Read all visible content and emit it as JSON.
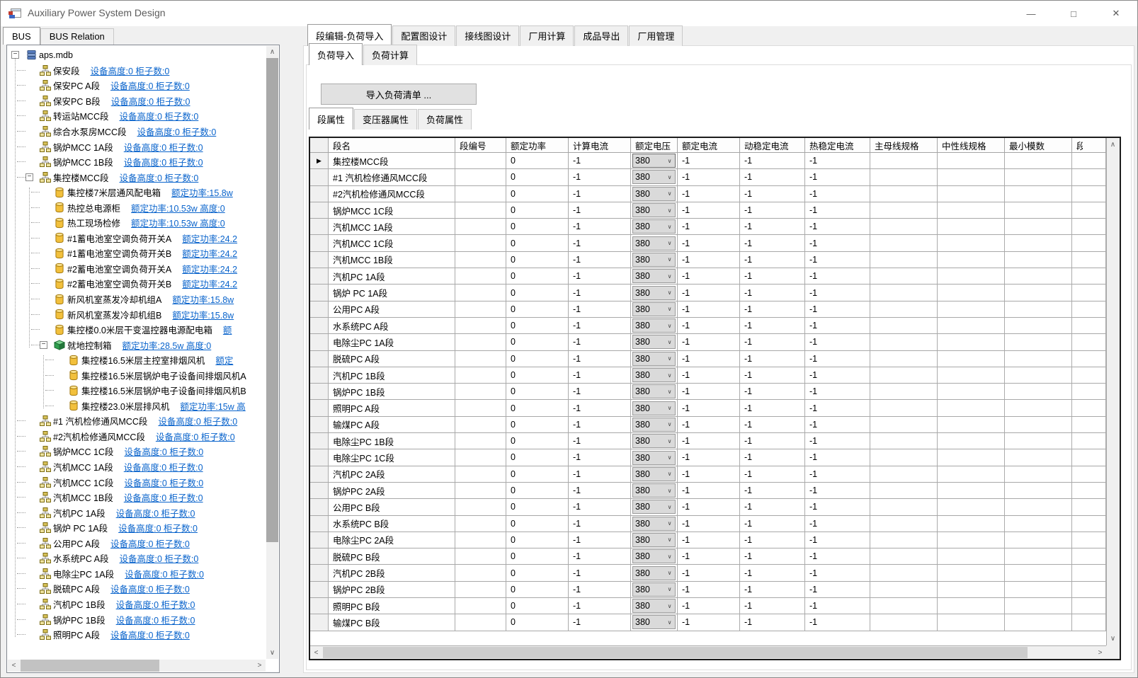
{
  "window": {
    "title": "Auxiliary Power System Design",
    "controls": {
      "minimize": "—",
      "maximize": "□",
      "close": "✕"
    }
  },
  "glyphs": {
    "minus": "−",
    "row_marker": "▶",
    "combo_arrow": "∨",
    "scroll_up": "∧",
    "scroll_down": "∨",
    "scroll_left": "<",
    "scroll_right": ">"
  },
  "colors": {
    "link_blue": "#0a64cc",
    "button_gray": "#e1e1e1",
    "combo_gray": "#dadada",
    "grid_border": "#1c1c1c",
    "form_bg": "#f0f0f0"
  },
  "left_panel": {
    "tabs": [
      {
        "label": "BUS",
        "selected": true
      },
      {
        "label": "BUS Relation",
        "selected": false
      }
    ],
    "tree": {
      "items": [
        {
          "level": 0,
          "icon": "database-icon",
          "expander": true,
          "name": "aps.mdb",
          "link": ""
        },
        {
          "level": 1,
          "icon": "section-icon",
          "expander": false,
          "name": "保安段",
          "link": "设备高度:0  柜子数:0"
        },
        {
          "level": 1,
          "icon": "section-icon",
          "expander": false,
          "name": "保安PC A段",
          "link": "设备高度:0  柜子数:0"
        },
        {
          "level": 1,
          "icon": "section-icon",
          "expander": false,
          "name": "保安PC B段",
          "link": "设备高度:0  柜子数:0"
        },
        {
          "level": 1,
          "icon": "section-icon",
          "expander": false,
          "name": "转运站MCC段",
          "link": "设备高度:0  柜子数:0"
        },
        {
          "level": 1,
          "icon": "section-icon",
          "expander": false,
          "name": "综合水泵房MCC段",
          "link": "设备高度:0  柜子数:0"
        },
        {
          "level": 1,
          "icon": "section-icon",
          "expander": false,
          "name": "锅炉MCC 1A段",
          "link": "设备高度:0  柜子数:0"
        },
        {
          "level": 1,
          "icon": "section-icon",
          "expander": false,
          "name": "锅炉MCC 1B段",
          "link": "设备高度:0  柜子数:0"
        },
        {
          "level": 1,
          "icon": "section-icon",
          "expander": true,
          "name": "集控楼MCC段",
          "link": "设备高度:0  柜子数:0"
        },
        {
          "level": 2,
          "icon": "load-icon",
          "expander": false,
          "name": "集控楼7米层通风配电箱",
          "link": "额定功率:15.8w"
        },
        {
          "level": 2,
          "icon": "load-icon",
          "expander": false,
          "name": "热控总电源柜",
          "link": "额定功率:10.53w 高度:0"
        },
        {
          "level": 2,
          "icon": "load-icon",
          "expander": false,
          "name": "热工现场检修",
          "link": "额定功率:10.53w 高度:0"
        },
        {
          "level": 2,
          "icon": "load-icon",
          "expander": false,
          "name": "#1蓄电池室空调负荷开关A",
          "link": "额定功率:24.2"
        },
        {
          "level": 2,
          "icon": "load-icon",
          "expander": false,
          "name": "#1蓄电池室空调负荷开关B",
          "link": "额定功率:24.2"
        },
        {
          "level": 2,
          "icon": "load-icon",
          "expander": false,
          "name": "#2蓄电池室空调负荷开关A",
          "link": "额定功率:24.2"
        },
        {
          "level": 2,
          "icon": "load-icon",
          "expander": false,
          "name": "#2蓄电池室空调负荷开关B",
          "link": "额定功率:24.2"
        },
        {
          "level": 2,
          "icon": "load-icon",
          "expander": false,
          "name": "新风机室蒸发冷却机组A",
          "link": "额定功率:15.8w"
        },
        {
          "level": 2,
          "icon": "load-icon",
          "expander": false,
          "name": "新风机室蒸发冷却机组B",
          "link": "额定功率:15.8w"
        },
        {
          "level": 2,
          "icon": "load-icon",
          "expander": false,
          "name": "集控楼0.0米层干变温控器电源配电箱",
          "link": "额"
        },
        {
          "level": 2,
          "icon": "box-icon",
          "expander": true,
          "name": "就地控制箱",
          "link": "额定功率:28.5w 高度:0"
        },
        {
          "level": 3,
          "icon": "load-icon",
          "expander": false,
          "name": "集控楼16.5米层主控室排烟风机",
          "link": "额定"
        },
        {
          "level": 3,
          "icon": "load-icon",
          "expander": false,
          "name": "集控楼16.5米层锅炉电子设备间排烟风机A",
          "link": ""
        },
        {
          "level": 3,
          "icon": "load-icon",
          "expander": false,
          "name": "集控楼16.5米层锅炉电子设备间排烟风机B",
          "link": ""
        },
        {
          "level": 3,
          "icon": "load-icon",
          "expander": false,
          "name": "集控楼23.0米层排风机",
          "link": "额定功率:15w 高"
        },
        {
          "level": 1,
          "icon": "section-icon",
          "expander": false,
          "name": "#1 汽机检修通风MCC段",
          "link": "设备高度:0  柜子数:0"
        },
        {
          "level": 1,
          "icon": "section-icon",
          "expander": false,
          "name": "#2汽机检修通风MCC段",
          "link": "设备高度:0  柜子数:0"
        },
        {
          "level": 1,
          "icon": "section-icon",
          "expander": false,
          "name": "锅炉MCC 1C段",
          "link": "设备高度:0  柜子数:0"
        },
        {
          "level": 1,
          "icon": "section-icon",
          "expander": false,
          "name": "汽机MCC 1A段",
          "link": "设备高度:0  柜子数:0"
        },
        {
          "level": 1,
          "icon": "section-icon",
          "expander": false,
          "name": "汽机MCC 1C段",
          "link": "设备高度:0  柜子数:0"
        },
        {
          "level": 1,
          "icon": "section-icon",
          "expander": false,
          "name": "汽机MCC 1B段",
          "link": "设备高度:0  柜子数:0"
        },
        {
          "level": 1,
          "icon": "section-icon",
          "expander": false,
          "name": "汽机PC 1A段",
          "link": "设备高度:0  柜子数:0"
        },
        {
          "level": 1,
          "icon": "section-icon",
          "expander": false,
          "name": "锅炉 PC 1A段",
          "link": "设备高度:0  柜子数:0"
        },
        {
          "level": 1,
          "icon": "section-icon",
          "expander": false,
          "name": "公用PC A段",
          "link": "设备高度:0  柜子数:0"
        },
        {
          "level": 1,
          "icon": "section-icon",
          "expander": false,
          "name": "水系统PC A段",
          "link": "设备高度:0  柜子数:0"
        },
        {
          "level": 1,
          "icon": "section-icon",
          "expander": false,
          "name": "电除尘PC 1A段",
          "link": "设备高度:0  柜子数:0"
        },
        {
          "level": 1,
          "icon": "section-icon",
          "expander": false,
          "name": "脱硫PC A段",
          "link": "设备高度:0  柜子数:0"
        },
        {
          "level": 1,
          "icon": "section-icon",
          "expander": false,
          "name": "汽机PC 1B段",
          "link": "设备高度:0  柜子数:0"
        },
        {
          "level": 1,
          "icon": "section-icon",
          "expander": false,
          "name": "锅炉PC 1B段",
          "link": "设备高度:0  柜子数:0"
        },
        {
          "level": 1,
          "icon": "section-icon",
          "expander": false,
          "name": "照明PC A段",
          "link": "设备高度:0  柜子数:0"
        }
      ]
    }
  },
  "main_panel": {
    "tabs": [
      {
        "label": "段编辑-负荷导入",
        "selected": true
      },
      {
        "label": "配置图设计",
        "selected": false
      },
      {
        "label": "接线图设计",
        "selected": false
      },
      {
        "label": "厂用计算",
        "selected": false
      },
      {
        "label": "成品导出",
        "selected": false
      },
      {
        "label": "厂用管理",
        "selected": false
      }
    ],
    "sub_tabs": [
      {
        "label": "负荷导入",
        "selected": true
      },
      {
        "label": "负荷计算",
        "selected": false
      }
    ],
    "import_button_label": "导入负荷清单 ...",
    "inner_tabs": [
      {
        "label": "段属性",
        "selected": true
      },
      {
        "label": "变压器属性",
        "selected": false
      },
      {
        "label": "负荷属性",
        "selected": false
      }
    ],
    "grid": {
      "columns": [
        "",
        "段名",
        "段编号",
        "额定功率",
        "计算电流",
        "额定电压",
        "额定电流",
        "动稳定电流",
        "热稳定电流",
        "主母线规格",
        "中性线规格",
        "最小模数",
        "段"
      ],
      "segment_names": [
        "集控楼MCC段",
        "#1 汽机检修通风MCC段",
        "#2汽机检修通风MCC段",
        "锅炉MCC 1C段",
        "汽机MCC 1A段",
        "汽机MCC 1C段",
        "汽机MCC 1B段",
        "汽机PC 1A段",
        "锅炉 PC 1A段",
        "公用PC A段",
        "水系统PC A段",
        "电除尘PC 1A段",
        "脱硫PC A段",
        "汽机PC 1B段",
        "锅炉PC 1B段",
        "照明PC A段",
        "输煤PC A段",
        "电除尘PC 1B段",
        "电除尘PC 1C段",
        "汽机PC 2A段",
        "锅炉PC 2A段",
        "公用PC B段",
        "水系统PC B段",
        "电除尘PC 2A段",
        "脱硫PC B段",
        "汽机PC 2B段",
        "锅炉PC 2B段",
        "照明PC B段",
        "输煤PC B段"
      ],
      "row_defaults": {
        "segment_no": "",
        "rated_power": "0",
        "calc_current": "-1",
        "rated_voltage": "380",
        "rated_current": "-1",
        "dynamic_stable_current": "-1",
        "thermal_stable_current": "-1",
        "main_bus_spec": "",
        "neutral_spec": "",
        "min_module": ""
      }
    }
  }
}
